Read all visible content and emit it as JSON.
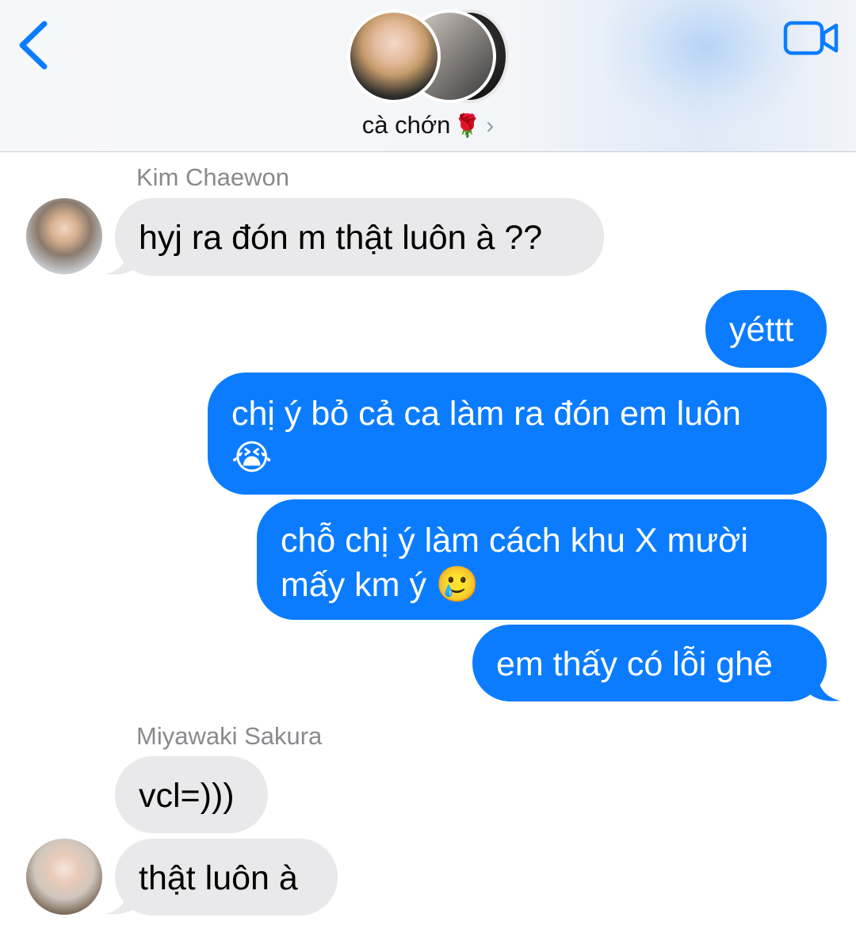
{
  "header": {
    "group_name": "cà chớn",
    "group_emoji": "🌹",
    "chevron": "›",
    "back_icon": "chevron-left-icon",
    "video_icon": "video-camera-icon"
  },
  "colors": {
    "accent": "#0b7cff",
    "incoming_bubble": "#e9e9eb",
    "sender_label": "#8a8a8e"
  },
  "messages": [
    {
      "sender": "Kim Chaewon",
      "text": "hyj ra đón m thật luôn à ??",
      "direction": "in"
    },
    {
      "text": "yéttt",
      "direction": "out"
    },
    {
      "text": "chị ý bỏ cả ca làm ra đón em luôn",
      "emoji": "😭",
      "direction": "out"
    },
    {
      "text_line1": "chỗ chị ý làm cách khu X mười",
      "text_line2": "mấy km ý",
      "emoji": "🥲",
      "direction": "out"
    },
    {
      "text": "em thấy có lỗi ghê",
      "direction": "out"
    },
    {
      "sender": "Miyawaki Sakura",
      "text": "vcl=)))",
      "direction": "in"
    },
    {
      "text": "thật luôn à",
      "direction": "in"
    }
  ]
}
